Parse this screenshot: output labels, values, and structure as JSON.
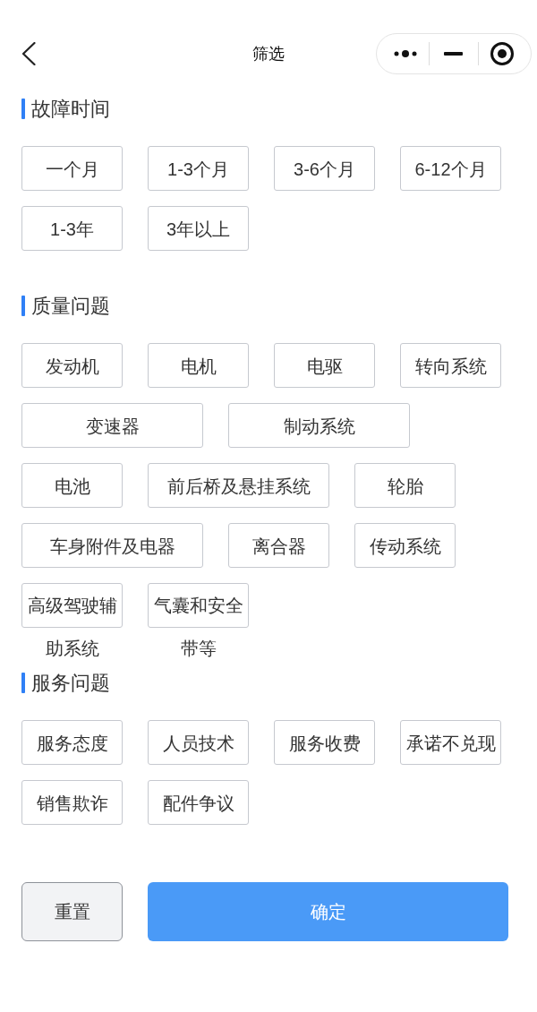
{
  "nav": {
    "title": "筛选"
  },
  "sections": [
    {
      "title": "故障时间",
      "options": [
        {
          "label": "一个月",
          "kind": "narrow",
          "selected": false
        },
        {
          "label": "1-3个月",
          "kind": "narrow",
          "selected": false
        },
        {
          "label": "3-6个月",
          "kind": "narrow",
          "selected": false
        },
        {
          "label": "6-12个月",
          "kind": "narrow",
          "selected": false
        },
        {
          "label": "1-3年",
          "kind": "narrow",
          "selected": false
        },
        {
          "label": "3年以上",
          "kind": "narrow",
          "selected": false
        }
      ]
    },
    {
      "title": "质量问题",
      "options": [
        {
          "label": "发动机",
          "kind": "narrow",
          "selected": false
        },
        {
          "label": "电机",
          "kind": "narrow",
          "selected": false
        },
        {
          "label": "电驱",
          "kind": "narrow",
          "selected": false
        },
        {
          "label": "转向系统",
          "kind": "narrow",
          "selected": false
        },
        {
          "label": "变速器",
          "kind": "wide",
          "selected": false
        },
        {
          "label": "制动系统",
          "kind": "wide",
          "selected": false
        },
        {
          "label": "电池",
          "kind": "narrow",
          "selected": false
        },
        {
          "label": "前后桥及悬挂系统",
          "kind": "wide",
          "selected": false
        },
        {
          "label": "轮胎",
          "kind": "narrow",
          "selected": false
        },
        {
          "label": "车身附件及电器",
          "kind": "wide",
          "selected": false
        },
        {
          "label": "离合器",
          "kind": "narrow",
          "selected": false
        },
        {
          "label": "传动系统",
          "kind": "narrow",
          "selected": false
        },
        {
          "label": "高级驾驶辅助系统",
          "kind": "narrow",
          "selected": false
        },
        {
          "label": "气囊和安全带等",
          "kind": "narrow",
          "selected": false
        }
      ]
    },
    {
      "title": "服务问题",
      "options": [
        {
          "label": "服务态度",
          "kind": "narrow",
          "selected": false
        },
        {
          "label": "人员技术",
          "kind": "narrow",
          "selected": false
        },
        {
          "label": "服务收费",
          "kind": "narrow",
          "selected": false
        },
        {
          "label": "承诺不兑现",
          "kind": "narrow",
          "selected": false
        },
        {
          "label": "销售欺诈",
          "kind": "narrow",
          "selected": false
        },
        {
          "label": "配件争议",
          "kind": "narrow",
          "selected": false
        }
      ]
    }
  ],
  "actions": [
    {
      "label": "重置",
      "kind": "secondary"
    },
    {
      "label": "确定",
      "kind": "primary"
    }
  ]
}
